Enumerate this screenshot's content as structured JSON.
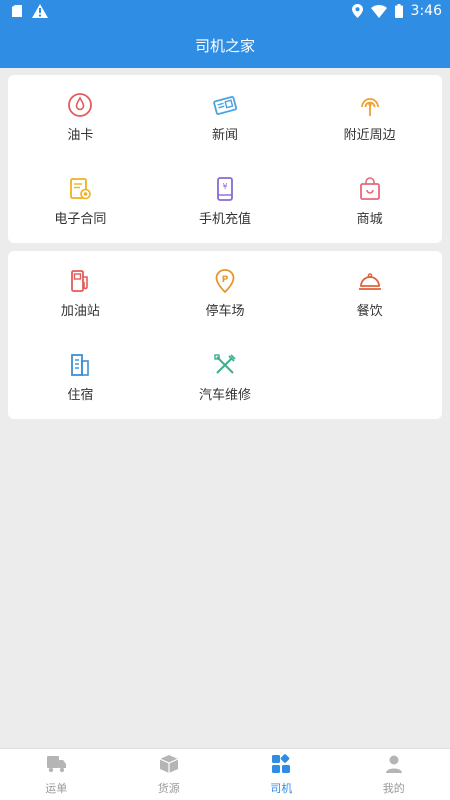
{
  "status_bar": {
    "time": "3:46"
  },
  "app_bar": {
    "title": "司机之家"
  },
  "section1": {
    "items": [
      {
        "label": "油卡",
        "icon": "oil-card-icon"
      },
      {
        "label": "新闻",
        "icon": "news-icon"
      },
      {
        "label": "附近周边",
        "icon": "nearby-icon"
      },
      {
        "label": "电子合同",
        "icon": "contract-icon"
      },
      {
        "label": "手机充值",
        "icon": "phone-recharge-icon"
      },
      {
        "label": "商城",
        "icon": "mall-icon"
      }
    ]
  },
  "section2": {
    "items": [
      {
        "label": "加油站",
        "icon": "gas-station-icon"
      },
      {
        "label": "停车场",
        "icon": "parking-icon"
      },
      {
        "label": "餐饮",
        "icon": "dining-icon"
      },
      {
        "label": "住宿",
        "icon": "hotel-icon"
      },
      {
        "label": "汽车维修",
        "icon": "car-repair-icon"
      }
    ]
  },
  "tab_bar": {
    "tabs": [
      {
        "label": "运单",
        "icon": "waybill-icon",
        "active": false
      },
      {
        "label": "货源",
        "icon": "cargo-icon",
        "active": false
      },
      {
        "label": "司机",
        "icon": "driver-icon",
        "active": true
      },
      {
        "label": "我的",
        "icon": "profile-icon",
        "active": false
      }
    ]
  },
  "colors": {
    "primary": "#2f8de4",
    "background": "#ececec",
    "inactive_tab": "#999999"
  }
}
